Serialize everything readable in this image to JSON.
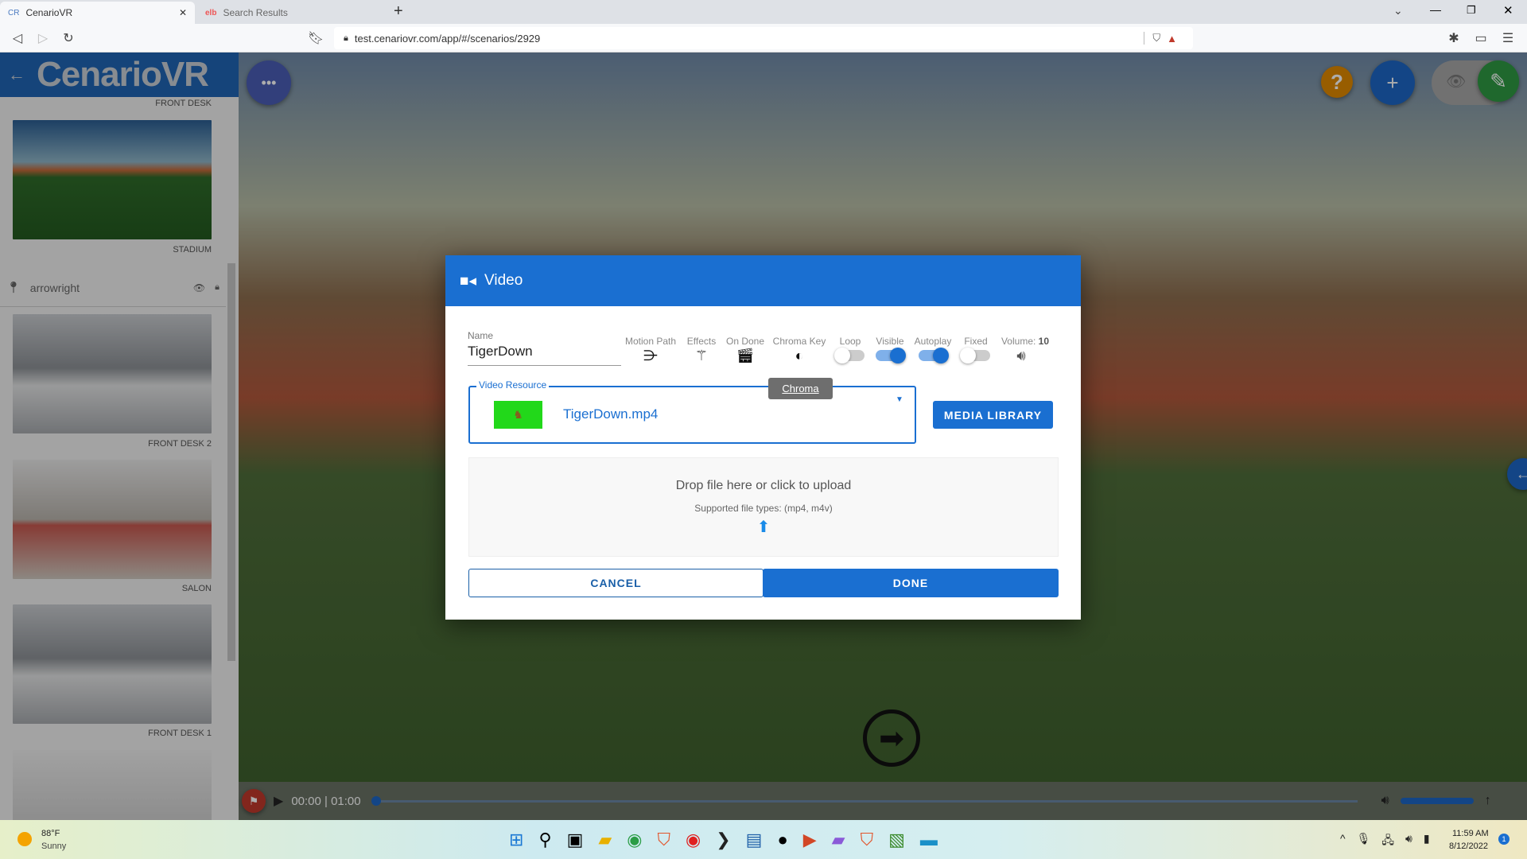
{
  "browser": {
    "tabs": [
      {
        "label": "CenarioVR",
        "active": true
      },
      {
        "label": "Search Results",
        "active": false
      }
    ],
    "url": "test.cenariovr.com/app/#/scenarios/2929"
  },
  "app": {
    "logo": "CenarioVR",
    "sidebar": {
      "top_label": "FRONT DESK",
      "scenes": [
        {
          "label": "STADIUM"
        },
        {
          "label": "FRONT DESK 2"
        },
        {
          "label": "SALON"
        },
        {
          "label": "FRONT DESK 1"
        }
      ],
      "hotspot": {
        "label": "arrowright"
      }
    }
  },
  "dialog": {
    "title": "Video",
    "name_label": "Name",
    "name_value": "TigerDown",
    "toolbar": {
      "motion_path": "Motion Path",
      "effects": "Effects",
      "on_done": "On Done",
      "chroma_key": "Chroma Key",
      "loop": "Loop",
      "visible": "Visible",
      "autoplay": "Autoplay",
      "fixed": "Fixed",
      "volume_label": "Volume:",
      "volume_value": "10"
    },
    "toggles": {
      "loop": false,
      "visible": true,
      "autoplay": true,
      "fixed": false
    },
    "tooltip": "Chroma",
    "resource_label": "Video Resource",
    "resource_value": "TigerDown.mp4",
    "media_library": "MEDIA LIBRARY",
    "drop_title": "Drop file here or click to upload",
    "drop_sub": "Supported file types: (mp4, m4v)",
    "cancel": "CANCEL",
    "done": "DONE"
  },
  "player": {
    "time": "00:00 | 01:00",
    "progress": 0,
    "volume": 0.95
  },
  "taskbar": {
    "temp": "88°F",
    "weather": "Sunny",
    "time": "11:59 AM",
    "date": "8/12/2022",
    "notifications": "1"
  },
  "colors": {
    "primary": "#1a6fd1",
    "sidebar_header": "#1f65b4",
    "help": "#e08a00",
    "edit": "#2e9a43"
  }
}
